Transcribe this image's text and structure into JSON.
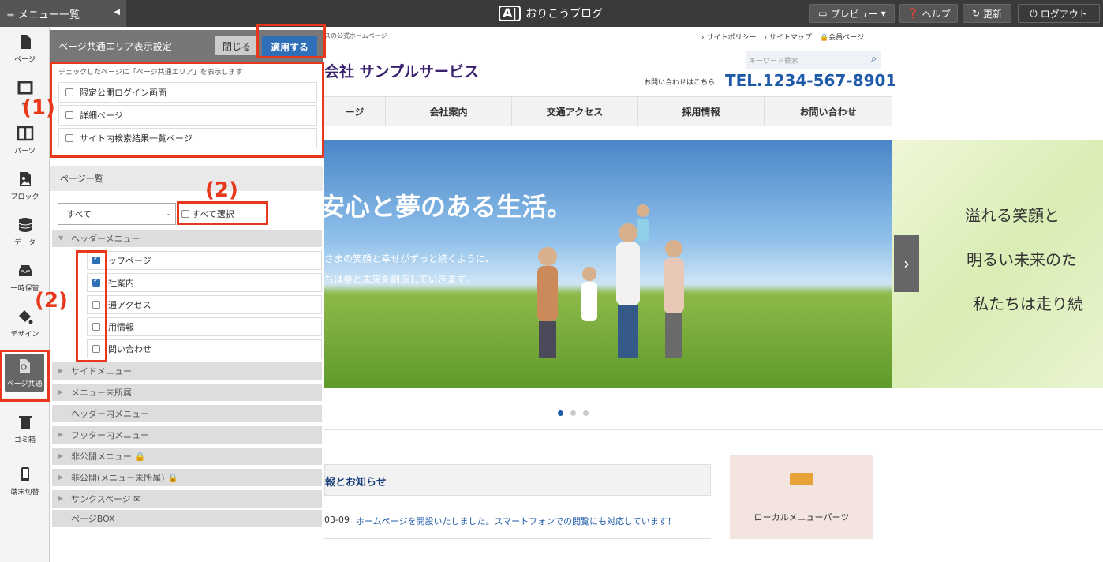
{
  "topbar": {
    "menu_label": "≡ メニュー一覧",
    "brand": "おりこうブログ",
    "brand_logo": "A|",
    "preview": "プレビュー",
    "help": "ヘルプ",
    "refresh": "更新",
    "logout": "ログアウト"
  },
  "leftnav": [
    {
      "label": "ページ",
      "icon": "page-icon"
    },
    {
      "label": "セ",
      "icon": "section-icon"
    },
    {
      "label": "パーツ",
      "icon": "parts-icon"
    },
    {
      "label": "ブロック",
      "icon": "image-icon"
    },
    {
      "label": "データ",
      "icon": "database-icon"
    },
    {
      "label": "一時保管",
      "icon": "inbox-icon"
    },
    {
      "label": "デザイン",
      "icon": "paint-icon"
    },
    {
      "label": "ページ共通",
      "icon": "page-common-icon"
    },
    {
      "label": "ゴミ箱",
      "icon": "trash-icon"
    },
    {
      "label": "端末切替",
      "icon": "mobile-icon"
    }
  ],
  "panel": {
    "title": "ページ共通エリア表示設定",
    "close": "閉じる",
    "apply": "適用する",
    "hint": "チェックしたページに「ページ共通エリア」を表示します",
    "options": [
      "限定公開ログイン画面",
      "詳細ページ",
      "サイト内検索結果一覧ページ"
    ],
    "list_title": "ページ一覧",
    "filter_value": "すべて",
    "select_all": "すべて選択",
    "header_menu": "ヘッダーメニュー",
    "pages": [
      {
        "label": "ップページ",
        "checked": true
      },
      {
        "label": "社案内",
        "checked": true
      },
      {
        "label": "通アクセス",
        "checked": false
      },
      {
        "label": "用情報",
        "checked": false
      },
      {
        "label": "問い合わせ",
        "checked": false
      }
    ],
    "groups": [
      "サイドメニュー",
      "メニュー未所属",
      "ヘッダー内メニュー",
      "フッター内メニュー",
      "非公開メニュー",
      "非公開(メニュー未所属)",
      "サンクスページ",
      "ページBOX"
    ]
  },
  "annotations": {
    "one": "(1)",
    "two": "(2)"
  },
  "site": {
    "tagline": "スの公式ホームページ",
    "links": [
      "› サイトポリシー",
      "› サイトマップ",
      "会員ページ"
    ],
    "company": "会社 サンプルサービス",
    "search_placeholder": "キーワード検索",
    "contact_label": "お問い合わせはこちら",
    "tel": "TEL.1234-567-8901",
    "nav": [
      "ージ",
      "会社案内",
      "交通アクセス",
      "採用情報",
      "お問い合わせ"
    ],
    "hero_title": "安心と夢のある生活。",
    "hero_line1": "さまの笑顔と幸せがずっと続くように、",
    "hero_line2": "ちは夢と未来を創造していきます。",
    "side_lines": [
      "溢れる笑顔と",
      "明るい未来のた",
      "私たちは走り続"
    ],
    "news_title": "報とお知らせ",
    "news_date": "03-09",
    "news_text": "ホームページを開設いたしました。スマートフォンでの閲覧にも対応しています！",
    "local_menu": "ローカルメニューパーツ"
  }
}
